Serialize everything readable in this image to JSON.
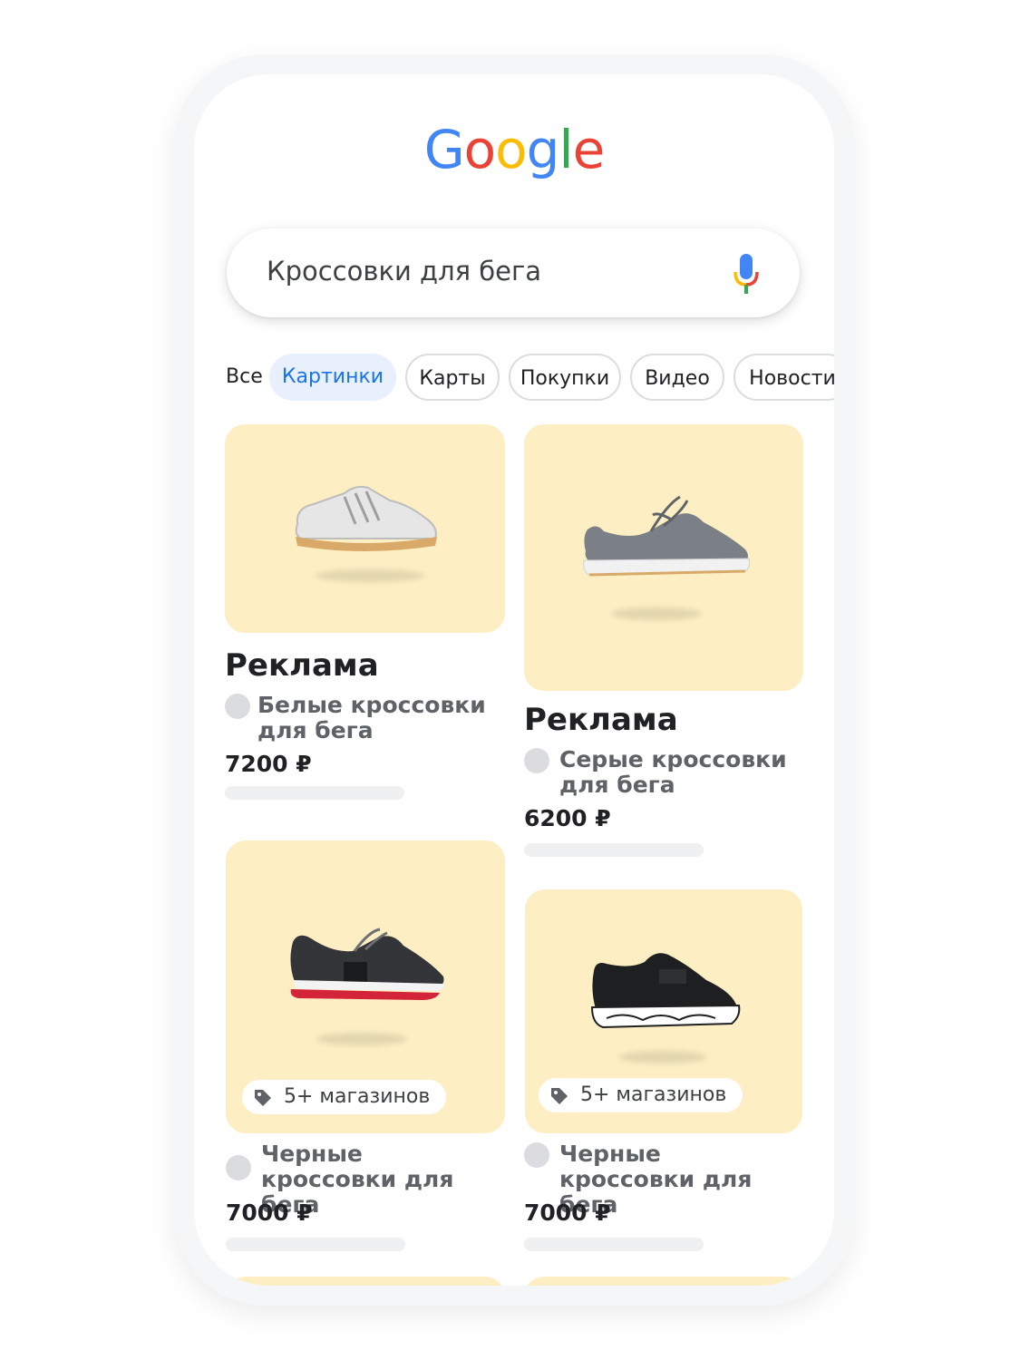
{
  "logo": {
    "letters": [
      "G",
      "o",
      "o",
      "g",
      "l",
      "e"
    ],
    "colors": [
      "#4285F4",
      "#EA4335",
      "#FBBC05",
      "#4285F4",
      "#34A853",
      "#EA4335"
    ]
  },
  "search": {
    "query": "Кроссовки для бега",
    "mic_icon": "mic-icon"
  },
  "tabs": [
    {
      "label": "Все",
      "active": false
    },
    {
      "label": "Картинки",
      "active": true
    },
    {
      "label": "Карты",
      "active": false
    },
    {
      "label": "Покупки",
      "active": false
    },
    {
      "label": "Видео",
      "active": false
    },
    {
      "label": "Новости",
      "active": false
    }
  ],
  "colors": {
    "card_bg": "#fdefc3",
    "active_tab_bg": "#e8f0fe",
    "active_tab_text": "#1a73e8"
  },
  "products": [
    {
      "ad_label": "Реклама",
      "name": "Белые кроссовки для бега",
      "price": "7200 ₽",
      "image": "white-sneaker"
    },
    {
      "ad_label": "Реклама",
      "name": "Серые кроссовки для бега",
      "price": "6200 ₽",
      "image": "grey-sneaker"
    },
    {
      "stores": "5+ магазинов",
      "name": "Черные кроссовки для бега",
      "price": "7000 ₽",
      "image": "black-red-sneaker"
    },
    {
      "stores": "5+ магазинов",
      "name": "Черные кроссовки для бега",
      "price": "7000 ₽",
      "image": "black-slip-on-sneaker"
    }
  ]
}
